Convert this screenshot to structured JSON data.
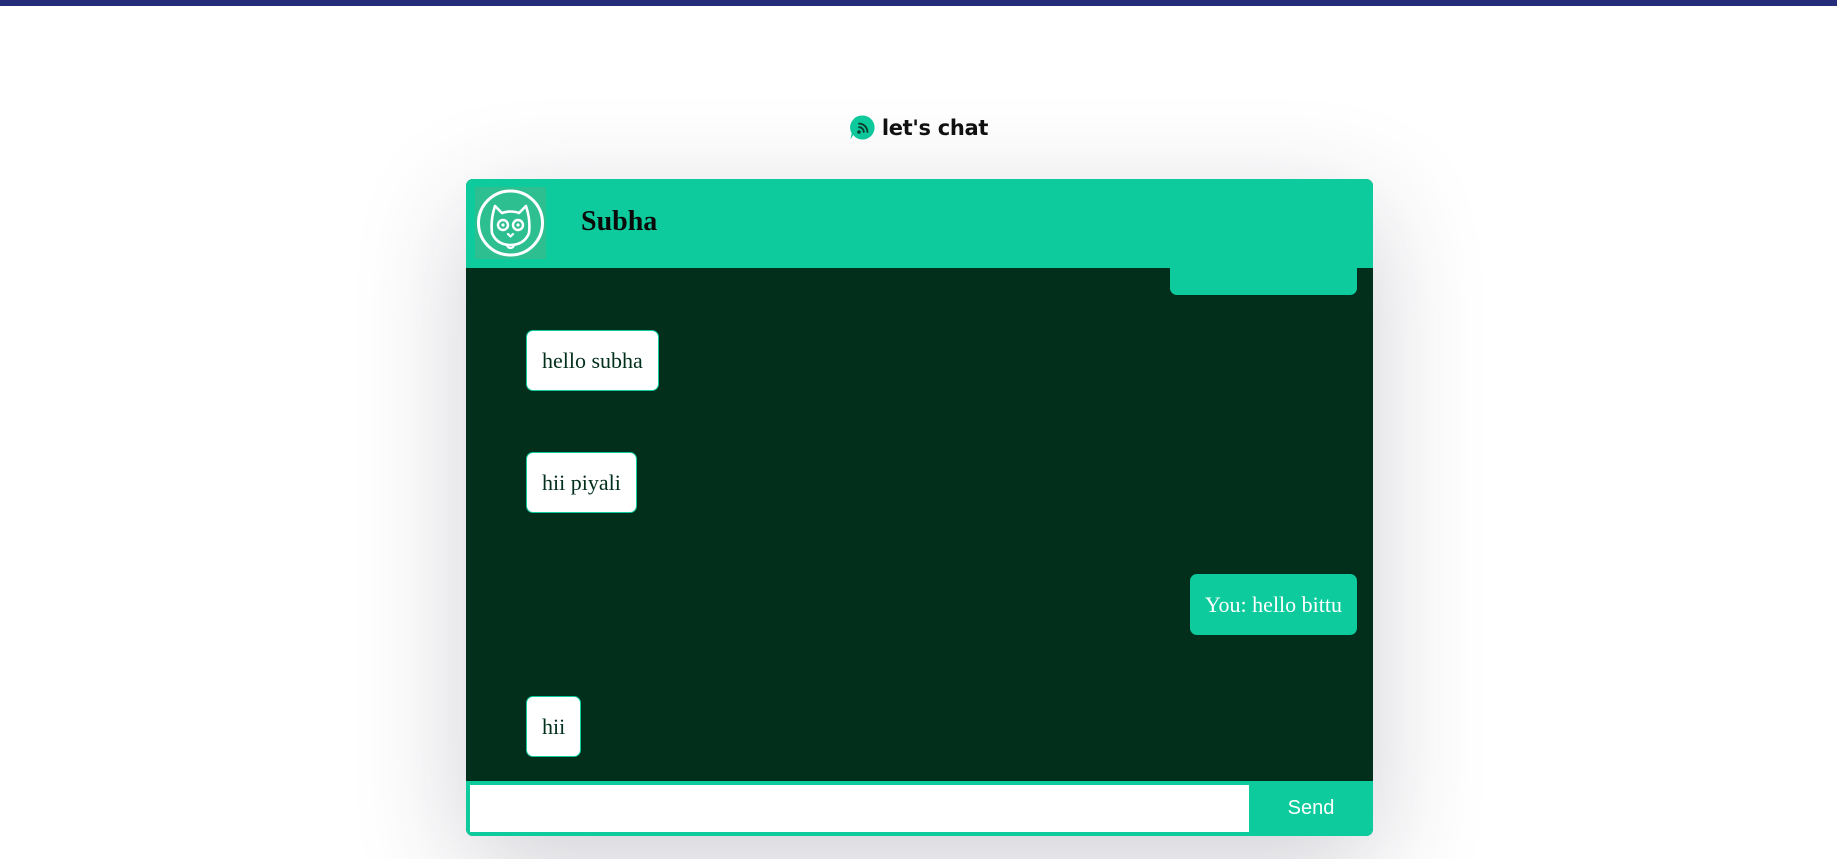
{
  "app": {
    "name": "let's chat",
    "icon": "chat-bubble-signal-icon"
  },
  "colors": {
    "accent": "#0ecb9d",
    "chat_background": "#022f1c",
    "topbar": "#252c7a",
    "incoming_bubble": "#ffffff",
    "outgoing_bubble": "#0ecb9d"
  },
  "chat": {
    "contact": {
      "name": "Subha",
      "avatar_icon": "cat-face-icon"
    },
    "messages": [
      {
        "direction": "out",
        "text": ""
      },
      {
        "direction": "in",
        "text": "hello subha"
      },
      {
        "direction": "in",
        "text": "hii piyali"
      },
      {
        "direction": "out",
        "text": "You: hello bittu"
      },
      {
        "direction": "in",
        "text": "hii"
      }
    ],
    "composer": {
      "value": "",
      "placeholder": "",
      "send_label": "Send"
    }
  }
}
